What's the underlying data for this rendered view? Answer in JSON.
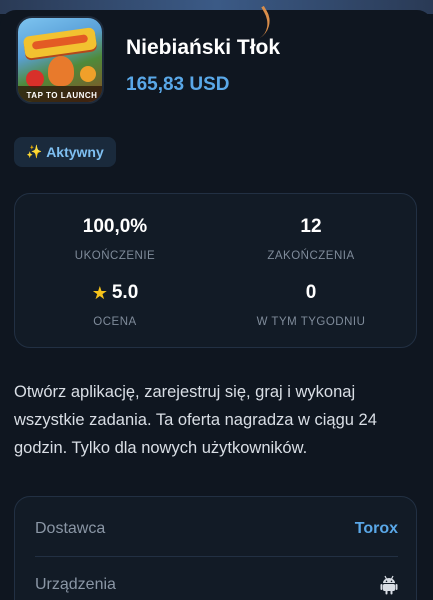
{
  "app": {
    "title": "Niebiański Tłok",
    "price": "165,83 USD",
    "icon_caption": "TAP TO LAUNCH",
    "icon_name": "game-icon"
  },
  "status_badge": {
    "icon": "sparkles-icon",
    "label": "Aktywny"
  },
  "stats": {
    "completion_value": "100,0%",
    "completion_label": "UKOŃCZENIE",
    "completions_value": "12",
    "completions_label": "ZAKOŃCZENIA",
    "rating_icon": "star-icon",
    "rating_value": "5.0",
    "rating_label": "OCENA",
    "week_value": "0",
    "week_label": "W TYM TYGODNIU"
  },
  "description": "Otwórz aplikację, zarejestruj się, graj i wykonaj wszystkie zadania. Ta oferta nagradza w ciągu 24 godzin. Tylko dla nowych użytkowników.",
  "details": {
    "provider_label": "Dostawca",
    "provider_value": "Torox",
    "devices_label": "Urządzenia",
    "devices_icon": "android-icon"
  },
  "colors": {
    "accent": "#5aa8e8",
    "background": "#0f1620",
    "card": "#121b26",
    "star": "#f5c21b"
  }
}
